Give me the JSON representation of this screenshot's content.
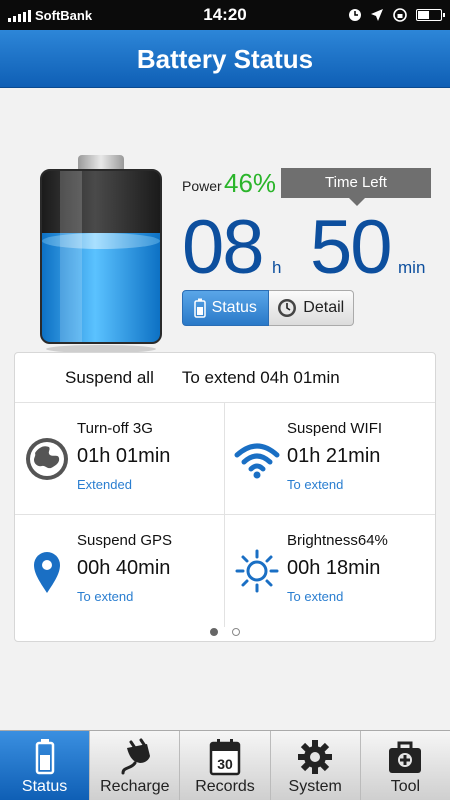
{
  "statusbar": {
    "carrier": "SoftBank",
    "time": "14:20"
  },
  "header": {
    "title": "Battery Status"
  },
  "battery": {
    "power_label": "Power",
    "power_value": "46%",
    "time_left_label": "Time Left",
    "hours": "08",
    "hours_unit": "h",
    "minutes": "50",
    "minutes_unit": "min",
    "level": 0.46
  },
  "segmented": {
    "status_label": "Status",
    "detail_label": "Detail"
  },
  "suspend": {
    "all_label": "Suspend all",
    "extend_label": "To extend 04h 01min",
    "items": [
      {
        "label": "Turn-off 3G",
        "time": "01h 01min",
        "status": "Extended",
        "icon": "globe-icon"
      },
      {
        "label": "Suspend WIFI",
        "time": "01h 21min",
        "status": "To extend",
        "icon": "wifi-icon"
      },
      {
        "label": "Suspend GPS",
        "time": "00h 40min",
        "status": "To extend",
        "icon": "map-pin-icon"
      },
      {
        "label": "Brightness64%",
        "time": "00h 18min",
        "status": "To extend",
        "icon": "sun-icon"
      }
    ]
  },
  "tabs": [
    {
      "label": "Status",
      "icon": "battery-icon"
    },
    {
      "label": "Recharge",
      "icon": "plug-icon"
    },
    {
      "label": "Records",
      "icon": "calendar-icon",
      "icon_text": "30"
    },
    {
      "label": "System",
      "icon": "gear-icon"
    },
    {
      "label": "Tool",
      "icon": "toolbox-icon"
    }
  ],
  "colors": {
    "accent": "#1a6fc4",
    "power_green": "#2bb52b",
    "digits_blue": "#0d4f9e",
    "link_blue": "#2a7ed0"
  }
}
